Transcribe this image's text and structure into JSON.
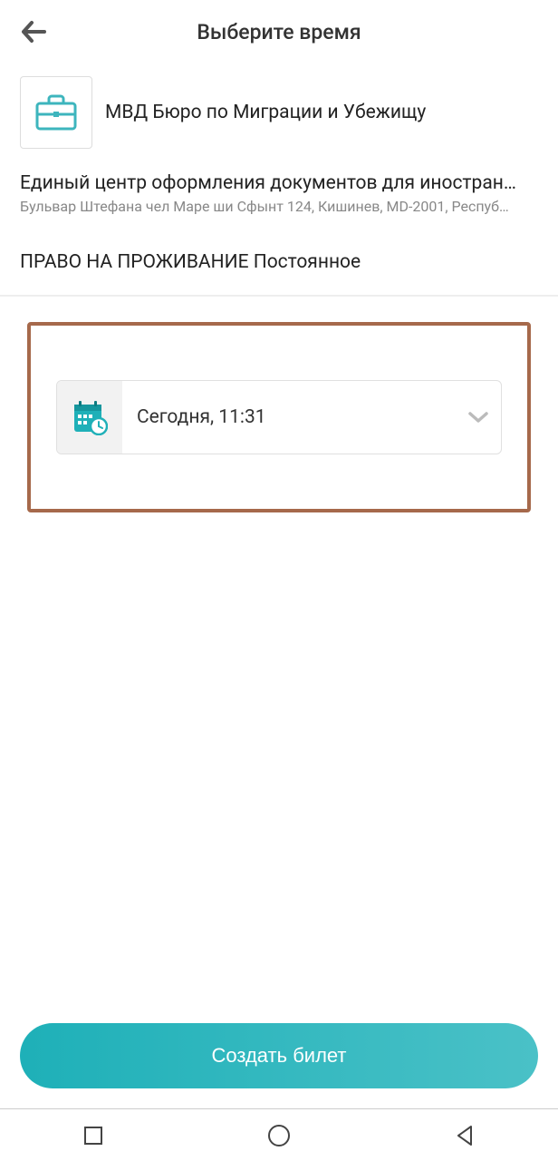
{
  "header": {
    "title": "Выберите время"
  },
  "organization": {
    "name": "МВД Бюро по Миграции и Убежищу"
  },
  "location": {
    "title": "Единый центр оформления документов для иностран…",
    "address": "Бульвар Штефана чел Маре ши Сфынт 124, Кишинев, MD-2001, Респуб…"
  },
  "service": {
    "name": "ПРАВО НА ПРОЖИВАНИЕ Постоянное"
  },
  "time_selector": {
    "selected": "Сегодня, 11:31"
  },
  "footer": {
    "button_label": "Создать билет"
  }
}
